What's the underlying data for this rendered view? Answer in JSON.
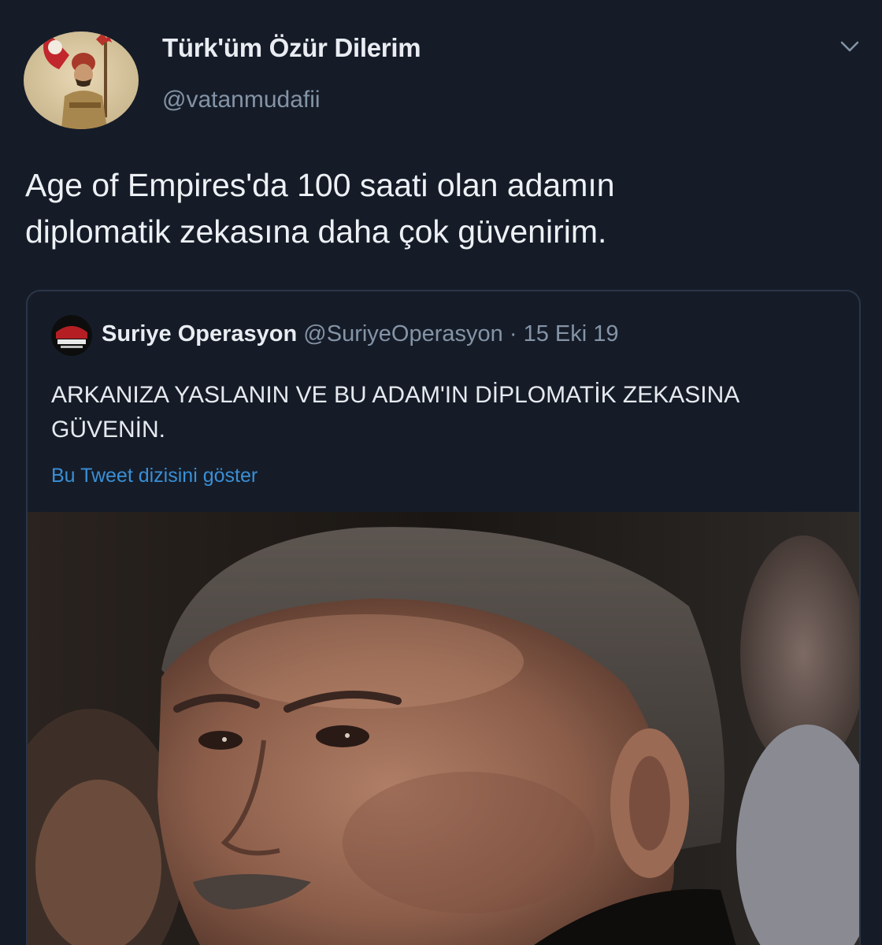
{
  "tweet": {
    "display_name": "Türk'üm Özür Dilerim",
    "handle": "@vatanmudafii",
    "text": "Age of Empires'da 100 saati olan adamın\ndiplomatik zekasına daha çok güvenirim."
  },
  "quoted_tweet": {
    "name": "Suriye Operasyon",
    "handle": "@SuriyeOperasyon",
    "separator": " · ",
    "date": "15 Eki 19",
    "text": "ARKANIZA YASLANIN VE BU ADAM'IN DİPLOMATİK ZEKASINA GÜVENİN.",
    "show_thread": "Bu Tweet dizisini göster"
  },
  "icons": {
    "menu": "chevron-down-icon"
  },
  "colors": {
    "background": "#151c28",
    "primary_text": "#e9edf2",
    "secondary_text": "#8494a6",
    "link": "#3a8fd6",
    "card_border": "#2a3647"
  }
}
